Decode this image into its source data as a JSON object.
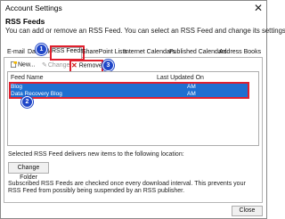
{
  "window": {
    "title": "Account Settings",
    "close_glyph": "✕"
  },
  "section": {
    "title": "RSS Feeds",
    "description": "You can add or remove an RSS Feed. You can select an RSS Feed and change its settings."
  },
  "tabs": [
    {
      "label": "E-mail"
    },
    {
      "label": "Data Files"
    },
    {
      "label": "RSS Feeds"
    },
    {
      "label": "SharePoint Lists"
    },
    {
      "label": "Internet Calendars"
    },
    {
      "label": "Published Calendars"
    },
    {
      "label": "Address Books"
    }
  ],
  "toolbar": {
    "new_label": "New...",
    "change_label": "Change...",
    "remove_label": "Remove"
  },
  "list": {
    "columns": [
      "Feed Name",
      "Last Updated On"
    ],
    "rows": [
      {
        "name": "Blog",
        "updated": "AM"
      },
      {
        "name": "Data Recovery Blog",
        "updated": "AM"
      }
    ]
  },
  "badges": [
    "1",
    "2",
    "3"
  ],
  "footer": {
    "location_text": "Selected RSS Feed delivers new items to the following location:",
    "change_folder_label": "Change Folder",
    "info_text": "Subscribed RSS Feeds are checked once every download interval. This prevents your RSS Feed from possibly being suspended by an RSS publisher.",
    "close_label": "Close"
  },
  "colors": {
    "selection": "#1f6fd1",
    "highlight": "#e0202e",
    "badge": "#1f46c8"
  }
}
